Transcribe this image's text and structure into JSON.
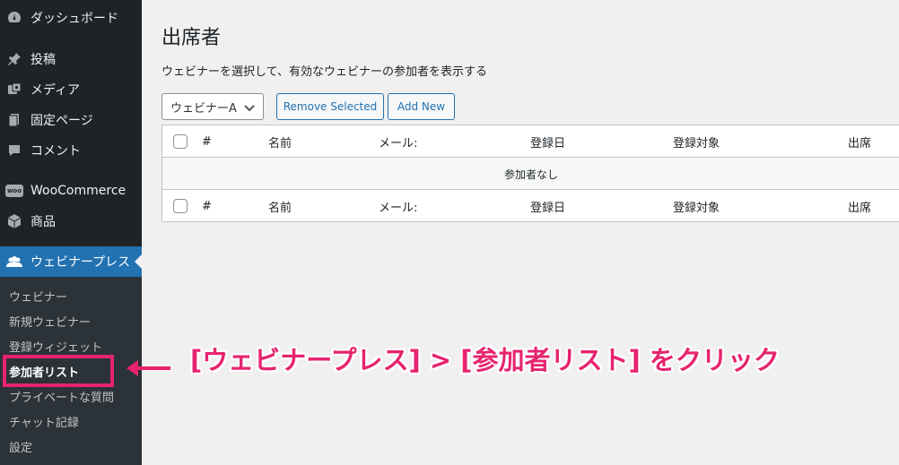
{
  "sidebar": {
    "items": [
      {
        "label": "ダッシュボード",
        "icon": "dashboard-icon"
      },
      {
        "label": "投稿",
        "icon": "pin-icon"
      },
      {
        "label": "メディア",
        "icon": "media-icon"
      },
      {
        "label": "固定ページ",
        "icon": "page-icon"
      },
      {
        "label": "コメント",
        "icon": "comment-icon"
      },
      {
        "label": "WooCommerce",
        "icon": "woocommerce-icon",
        "icon_text": "woo"
      },
      {
        "label": "商品",
        "icon": "box-icon"
      },
      {
        "label": "ウェビナープレス",
        "icon": "users-icon"
      }
    ],
    "submenu": [
      {
        "label": "ウェビナー"
      },
      {
        "label": "新規ウェビナー"
      },
      {
        "label": "登録ウィジェット"
      },
      {
        "label": "参加者リスト"
      },
      {
        "label": "プライベートな質問"
      },
      {
        "label": "チャット記録"
      },
      {
        "label": "設定"
      }
    ]
  },
  "main": {
    "title": "出席者",
    "description": "ウェビナーを選択して、有効なウェビナーの参加者を表示する",
    "webinar_select": {
      "value": "ウェビナーA"
    },
    "buttons": {
      "remove_selected": "Remove Selected",
      "add_new": "Add New"
    },
    "table": {
      "columns": [
        "#",
        "名前",
        "メール:",
        "登録日",
        "登録対象",
        "出席"
      ],
      "empty_message": "参加者なし"
    }
  },
  "annotation": {
    "text": "[ウェビナープレス] > [参加者リスト] をクリック",
    "color": "#e6246f"
  },
  "colors": {
    "accent": "#2271b1",
    "sidebar_bg": "#1d2327",
    "submenu_bg": "#2c3338"
  }
}
